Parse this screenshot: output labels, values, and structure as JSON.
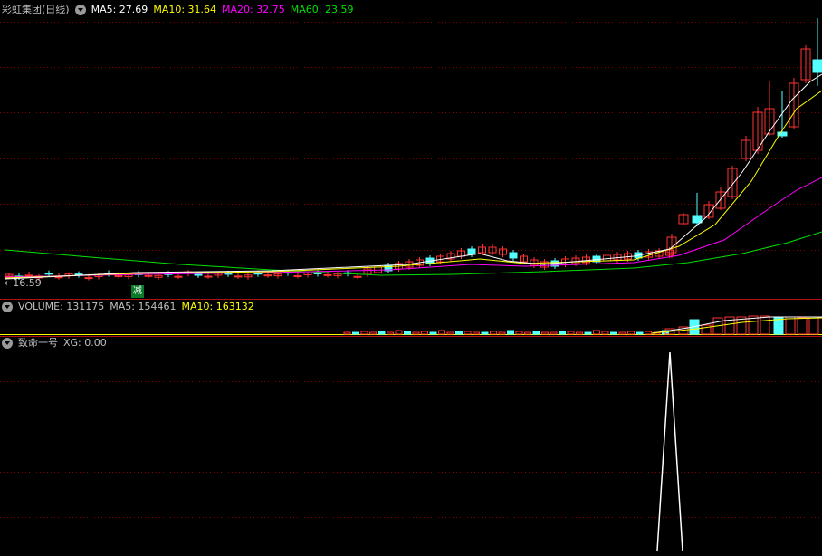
{
  "stock": {
    "title": "彩虹集团(日线)"
  },
  "price_legend": {
    "ma5": "MA5: 27.69",
    "ma10": "MA10: 31.64",
    "ma20": "MA20: 32.75",
    "ma60": "MA60: 23.59"
  },
  "low_marker": "←16.59",
  "reduce_badge": "减",
  "volume_legend": {
    "volume": "VOLUME: 131175",
    "ma5": "MA5: 154461",
    "ma10": "MA10: 163132"
  },
  "indicator_legend": {
    "name": "致命一号",
    "xg": "XG: 0.00"
  },
  "colors": {
    "up": "#ff3232",
    "down": "#54ffff",
    "ma5": "#ffffff",
    "ma10": "#ffff00",
    "ma20": "#ff00ff",
    "ma60": "#00e000",
    "grid": "#8a0000"
  }
}
